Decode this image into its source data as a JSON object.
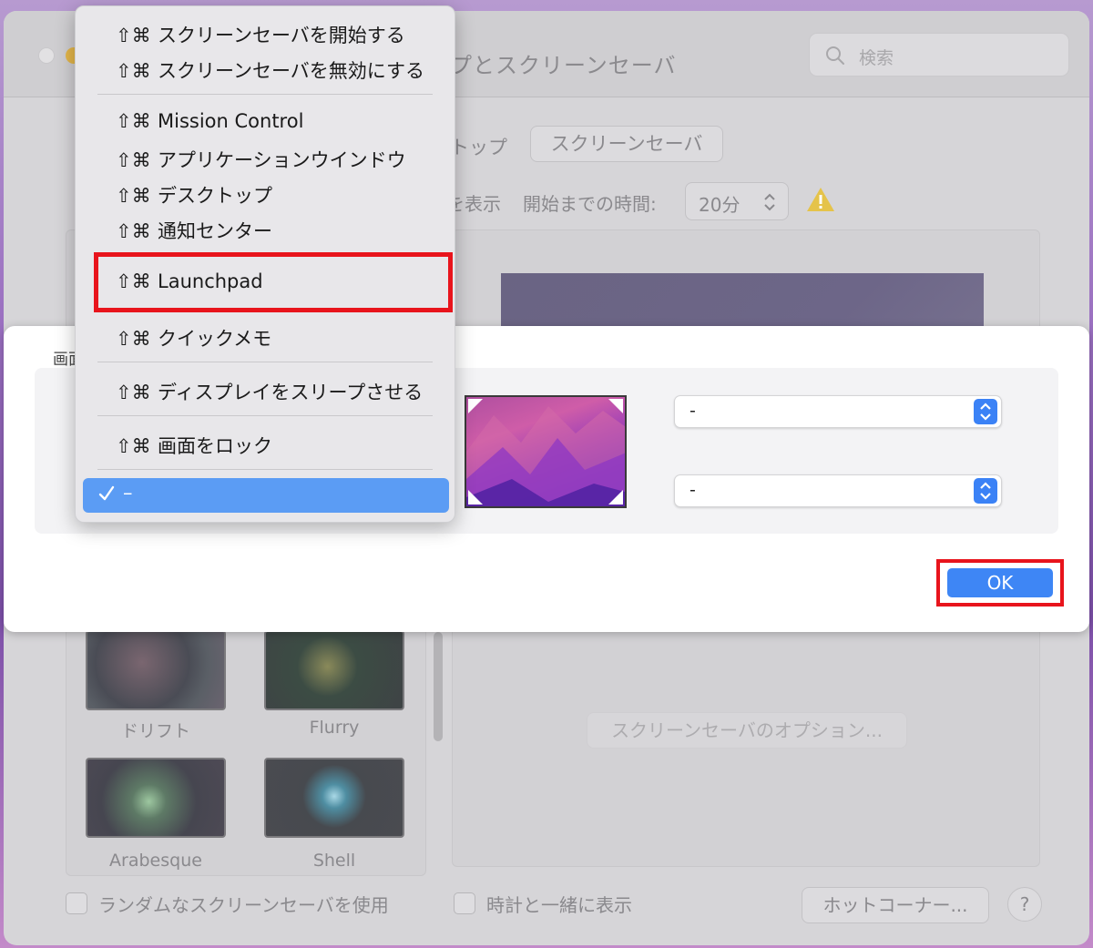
{
  "window": {
    "title": "プとスクリーンセーバ",
    "search_placeholder": "検索",
    "tabs": [
      "トップ",
      "スクリーンセーバ"
    ],
    "show_label": "を表示",
    "start_time_label": "開始までの時間:",
    "start_time_value": "20分",
    "options_button": "スクリーンセーバのオプション...",
    "savers": [
      "ドリフト",
      "Flurry",
      "Arabesque",
      "Shell"
    ],
    "random_checkbox": "ランダムなスクリーンセーバを使用",
    "clock_checkbox": "時計と一緒に表示",
    "hot_corners_button": "ホットコーナー...",
    "help_button": "?"
  },
  "sheet": {
    "title_fragment": "画面",
    "popup_top_right": "-",
    "popup_bottom_right": "-",
    "ok_label": "OK"
  },
  "menu": {
    "modifier": "⇧⌘",
    "items": [
      "スクリーンセーバを開始する",
      "スクリーンセーバを無効にする",
      "Mission Control",
      "アプリケーションウインドウ",
      "デスクトップ",
      "通知センター",
      "Launchpad",
      "クイックメモ",
      "ディスプレイをスリープさせる",
      "画面をロック"
    ],
    "selected_label": "–"
  },
  "colors": {
    "highlight_red": "#e8141c",
    "accent_blue": "#3e86f5",
    "menu_selection": "#5b9cf4"
  }
}
